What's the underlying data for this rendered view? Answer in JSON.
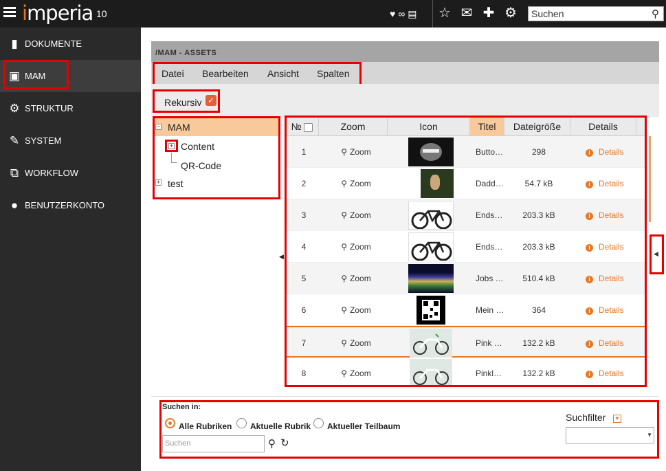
{
  "topbar": {
    "brand_prefix": "i",
    "brand_rest": "mperia",
    "version": "10",
    "search_placeholder": "Suchen",
    "icons": [
      "heart-icon",
      "glasses-icon",
      "document-icon",
      "star-icon",
      "mail-icon",
      "puzzle-icon",
      "gear-icon",
      "search-icon"
    ]
  },
  "sidebar": {
    "items": [
      {
        "label": "DOKUMENTE",
        "icon": "document-icon"
      },
      {
        "label": "MAM",
        "icon": "image-icon"
      },
      {
        "label": "STRUKTUR",
        "icon": "gears-icon"
      },
      {
        "label": "SYSTEM",
        "icon": "wrench-icon"
      },
      {
        "label": "WORKFLOW",
        "icon": "sitemap-icon"
      },
      {
        "label": "BENUTZERKONTO",
        "icon": "user-icon"
      }
    ]
  },
  "main": {
    "title": "/MAM - ASSETS",
    "menu": [
      "Datei",
      "Bearbeiten",
      "Ansicht",
      "Spalten"
    ],
    "recursive_label": "Rekursiv",
    "recursive_checked": true
  },
  "tree": {
    "nodes": [
      "MAM",
      "Content",
      "QR-Code",
      "test"
    ]
  },
  "grid": {
    "headers": {
      "no": "№",
      "zoom": "Zoom",
      "icon": "Icon",
      "title": "Titel",
      "size": "Dateigröße",
      "details": "Details"
    },
    "rows": [
      {
        "no": "1",
        "zoom": "Zoom",
        "title": "Butto…",
        "size": "298",
        "details": "Details"
      },
      {
        "no": "2",
        "zoom": "Zoom",
        "title": "Dadd…",
        "size": "54.7 kB",
        "details": "Details"
      },
      {
        "no": "3",
        "zoom": "Zoom",
        "title": "Ends…",
        "size": "203.3 kB",
        "details": "Details"
      },
      {
        "no": "4",
        "zoom": "Zoom",
        "title": "Ends…",
        "size": "203.3 kB",
        "details": "Details"
      },
      {
        "no": "5",
        "zoom": "Zoom",
        "title": "Jobs …",
        "size": "510.4 kB",
        "details": "Details"
      },
      {
        "no": "6",
        "zoom": "Zoom",
        "title": "Mein …",
        "size": "364",
        "details": "Details"
      },
      {
        "no": "7",
        "zoom": "Zoom",
        "title": "Pink …",
        "size": "132.2 kB",
        "details": "Details"
      },
      {
        "no": "8",
        "zoom": "Zoom",
        "title": "Pinkl…",
        "size": "132.2 kB",
        "details": "Details"
      }
    ]
  },
  "search_panel": {
    "label": "Suchen in:",
    "options": [
      "Alle Rubriken",
      "Aktuelle Rubrik",
      "Aktueller Teilbaum"
    ],
    "selected": "Alle Rubriken",
    "input_placeholder": "Suchen",
    "filter_label": "Suchfilter",
    "filter_value": ""
  },
  "colors": {
    "accent": "#e87722",
    "highlight": "#e50000",
    "sidebar": "#2a2a2a"
  }
}
